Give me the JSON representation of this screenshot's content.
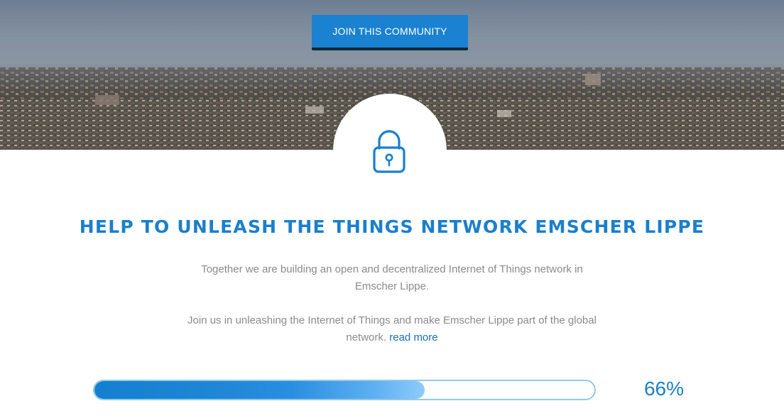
{
  "hero": {
    "join_button_label": "JOIN THIS COMMUNITY"
  },
  "lock": {
    "icon": "padlock-icon"
  },
  "headline": "HELP TO UNLEASH THE THINGS NETWORK EMSCHER LIPPE",
  "intro": {
    "paragraph_1": "Together we are building an open and decentralized Internet of Things network in Emscher Lippe.",
    "paragraph_2": "Join us in unleashing the Internet of Things and make Emscher Lippe part of the global network.",
    "read_more_label": "read more"
  },
  "progress": {
    "percent_label": "66%",
    "value": 0.66
  },
  "colors": {
    "accent": "#1b7fcb",
    "button": "#1a82d0",
    "body_text": "#8a8a8a",
    "link": "#1a6fb5"
  }
}
